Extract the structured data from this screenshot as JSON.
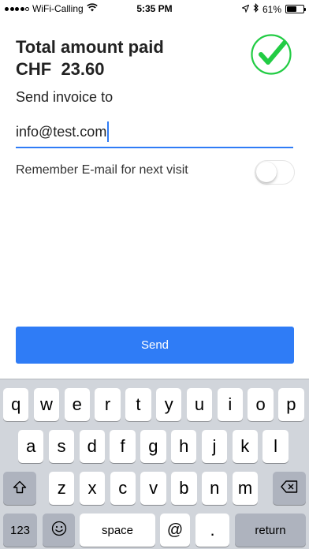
{
  "status_bar": {
    "carrier": "WiFi-Calling",
    "time": "5:35 PM",
    "battery": "61%",
    "battery_level": 0.61,
    "icons": [
      "signal-dots-icon",
      "wifi-icon",
      "location-arrow-icon",
      "bluetooth-icon",
      "battery-icon"
    ]
  },
  "payment": {
    "title_line1": "Total amount paid",
    "title_line2": "CHF  23.60",
    "success_icon": "check-circle-icon",
    "success_color": "#22cc44"
  },
  "invoice": {
    "label": "Send invoice to",
    "email_value": "info@test.com",
    "accent_color": "#2f7cf6"
  },
  "remember": {
    "label": "Remember E-mail for next visit",
    "toggle_on": false
  },
  "send_button": {
    "label": "Send",
    "color": "#2f7cf6"
  },
  "keyboard": {
    "row1": [
      "q",
      "w",
      "e",
      "r",
      "t",
      "y",
      "u",
      "i",
      "o",
      "p"
    ],
    "row2": [
      "a",
      "s",
      "d",
      "f",
      "g",
      "h",
      "j",
      "k",
      "l"
    ],
    "row3": [
      "z",
      "x",
      "c",
      "v",
      "b",
      "n",
      "m"
    ],
    "shift_icon": "shift-icon",
    "delete_icon": "backspace-icon",
    "numbers_label": "123",
    "emoji_icon": "emoji-icon",
    "space_label": "space",
    "at_label": "@",
    "dot_label": ".",
    "return_label": "return"
  }
}
